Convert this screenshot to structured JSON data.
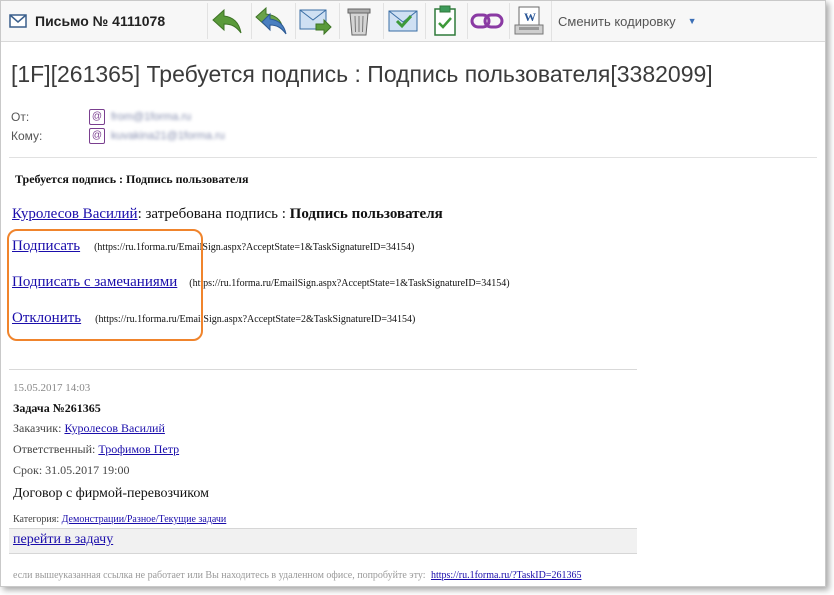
{
  "toolbar": {
    "title": "Письмо № 4111078",
    "buttons": [
      "reply",
      "reply-all",
      "forward",
      "delete",
      "accept",
      "task",
      "link",
      "word"
    ],
    "encoding_label": "Сменить кодировку"
  },
  "subject": "[1F][261365] Требуется подпись : Подпись пользователя[3382099]",
  "headers": {
    "from_label": "От:",
    "from_value": "from@1forma.ru",
    "to_label": "Кому:",
    "to_value": "kuvakina21@1forma.ru"
  },
  "body": {
    "heading": "Требуется подпись : Подпись пользователя",
    "requester_link": "Куролесов Василий",
    "request_text": ": затребована подпись :",
    "request_bold": "Подпись пользователя",
    "actions": [
      {
        "label": "Подписать",
        "url": "(https://ru.1forma.ru/EmailSign.aspx?AcceptState=1&TaskSignatureID=34154)"
      },
      {
        "label": "Подписать с замечаниями",
        "url": "(https://ru.1forma.ru/EmailSign.aspx?AcceptState=1&TaskSignatureID=34154)"
      },
      {
        "label": "Отклонить",
        "url": "(https://ru.1forma.ru/EmailSign.aspx?AcceptState=2&TaskSignatureID=34154)"
      }
    ]
  },
  "task": {
    "date": "15.05.2017 14:03",
    "title": "Задача №261365",
    "customer_label": "Заказчик:",
    "customer": "Куролесов Василий",
    "responsible_label": "Ответственный:",
    "responsible": "Трофимов Петр",
    "deadline": "Срок: 31.05.2017 19:00",
    "description": "Договор с фирмой-перевозчиком",
    "category_label": "Категория:",
    "category": "Демонстрации/Разное/Текущие задачи",
    "goto_link": "перейти в задачу",
    "footer_text": "если вышеуказанная ссылка не работает или Вы находитесь в удаленном офисе, попробуйте эту:",
    "footer_link": "https://ru.1forma.ru/?TaskID=261365"
  }
}
